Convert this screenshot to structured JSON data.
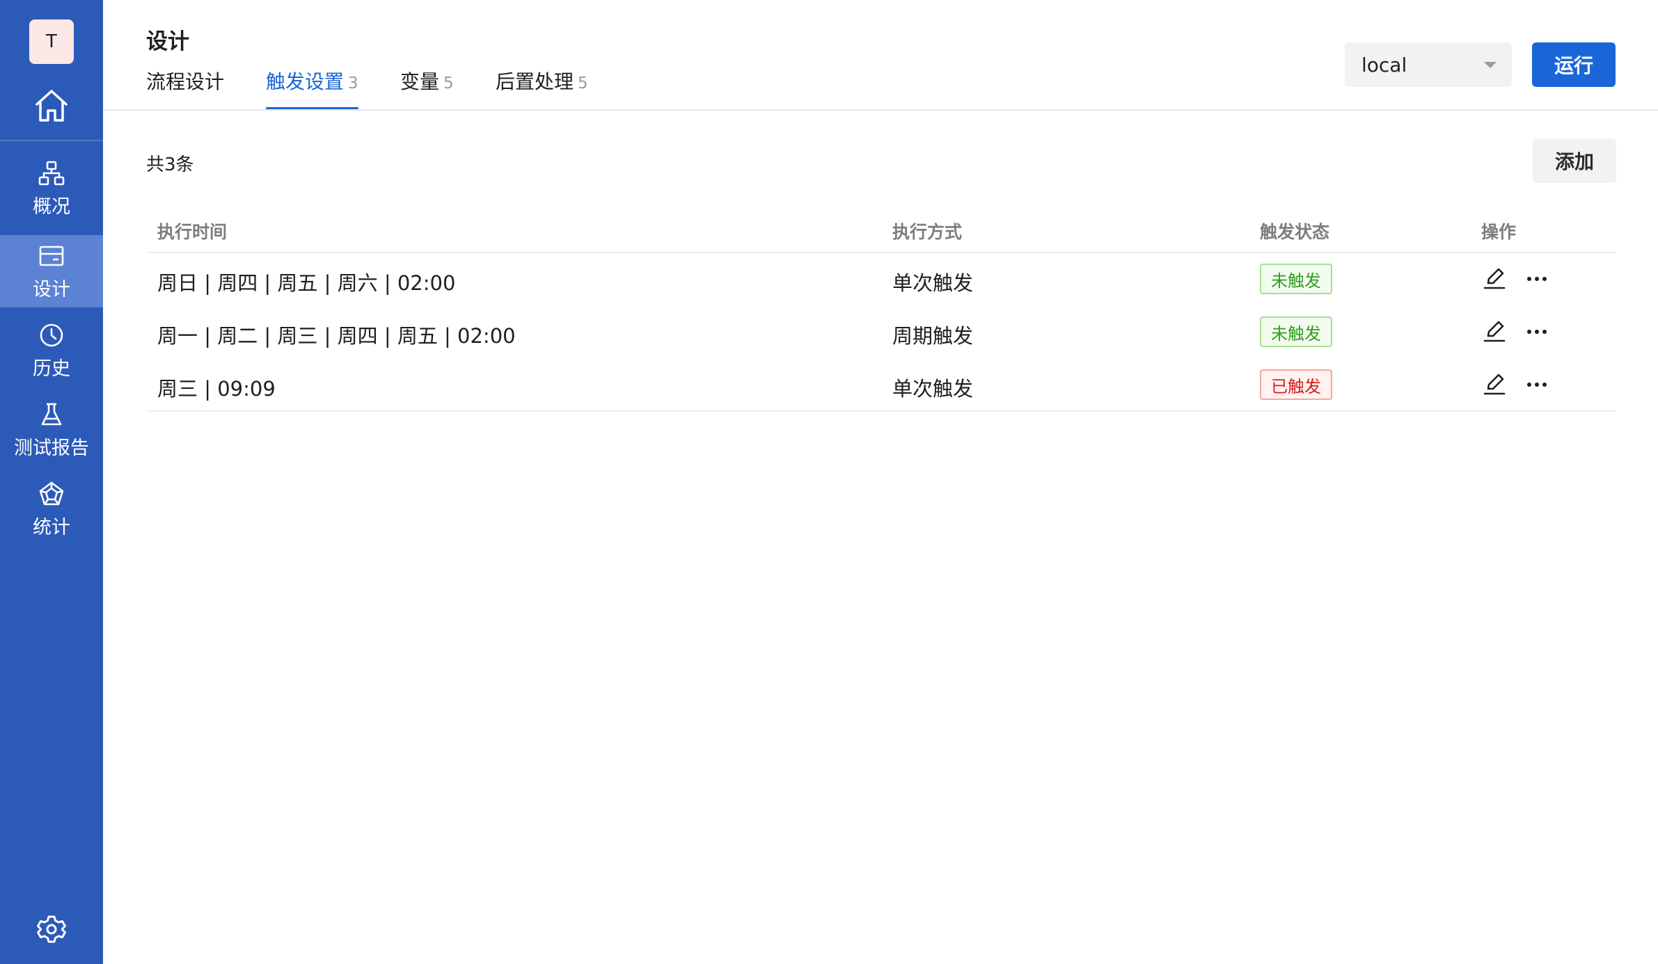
{
  "sidebar": {
    "avatar_letter": "T",
    "items": [
      {
        "label": "概况",
        "icon": "sitemap-icon"
      },
      {
        "label": "设计",
        "icon": "layout-card-icon",
        "active": true
      },
      {
        "label": "历史",
        "icon": "clock-icon"
      },
      {
        "label": "测试报告",
        "icon": "flask-icon"
      },
      {
        "label": "统计",
        "icon": "pentagon-chart-icon"
      }
    ],
    "home_icon": "home-icon",
    "settings_icon": "gear-icon"
  },
  "header": {
    "title": "设计",
    "tabs": [
      {
        "label": "流程设计",
        "count": ""
      },
      {
        "label": "触发设置",
        "count": "3",
        "active": true
      },
      {
        "label": "变量",
        "count": "5"
      },
      {
        "label": "后置处理",
        "count": "5"
      }
    ],
    "environment": {
      "selected": "local"
    },
    "run_label": "运行"
  },
  "content": {
    "total_text": "共3条",
    "add_label": "添加",
    "columns": [
      "执行时间",
      "执行方式",
      "触发状态",
      "操作"
    ],
    "rows": [
      {
        "time": "周日 | 周四 | 周五 | 周六 | 02:00",
        "mode": "单次触发",
        "status": "未触发",
        "status_type": "pending"
      },
      {
        "time": "周一 | 周二 | 周三 | 周四 | 周五 | 02:00",
        "mode": "周期触发",
        "status": "未触发",
        "status_type": "pending"
      },
      {
        "time": "周三 | 09:09",
        "mode": "单次触发",
        "status": "已触发",
        "status_type": "done"
      }
    ]
  },
  "colors": {
    "sidebar_bg": "#2c5ab8",
    "sidebar_active": "#5b82d3",
    "accent": "#1a66d9",
    "pending_green": "#2f9e1f",
    "done_red": "#d42020"
  }
}
